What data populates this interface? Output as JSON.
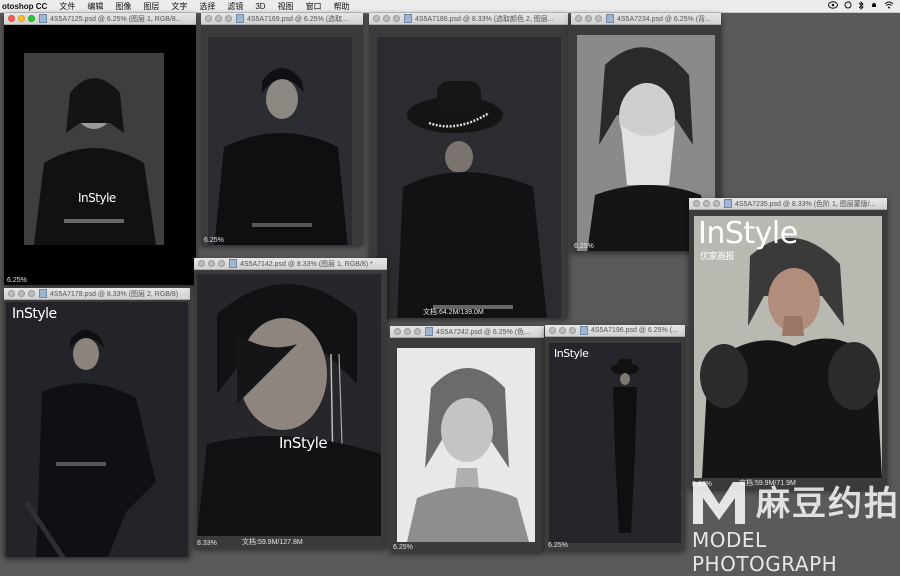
{
  "menubar": {
    "app_name": "otoshop CC",
    "items": [
      "文件",
      "编辑",
      "图像",
      "图层",
      "文字",
      "选择",
      "滤镜",
      "3D",
      "视图",
      "窗口",
      "帮助"
    ],
    "status_icons": [
      "creative-cloud-icon",
      "sync-icon",
      "bluetooth-icon",
      "bell-icon",
      "wifi-icon"
    ]
  },
  "windows": {
    "w1": {
      "title": "4S5A7125.psd @ 6.25% (图层 1, RGB/8...",
      "zoom": "6.25%",
      "brand": "InStyle"
    },
    "w2": {
      "title": "4S5A7169.psd @ 6.25% (选取...",
      "zoom": "6.25%"
    },
    "w3": {
      "title": "4S5A7186.psd @ 8.33% (选取颜色 2, 图层...",
      "doc_info": "文档:64.2M/139.0M"
    },
    "w4": {
      "title": "4S5A7234.psd @ 6.25% (背...",
      "zoom": "6.25%"
    },
    "w5": {
      "title": "4S5A7235.psd @ 8.33% (色阶 1, 图层蒙版/...",
      "zoom": "8.33%",
      "doc_info": "文档:59.9M/71.9M",
      "brand": "InStyle",
      "brand_sub": "优家画报"
    },
    "w6": {
      "title": "4S5A7178.psd @ 8.33% (图层 2, RGB/8)",
      "brand": "InStyle"
    },
    "w7": {
      "title": "4S5A7142.psd @ 8.33% (图层 1, RGB/8) *",
      "zoom": "8.33%",
      "doc_info": "文档:59.9M/127.8M",
      "brand": "InStyle"
    },
    "w8": {
      "title": "4S5A7242.psd @ 6.25% (色...",
      "zoom": "6.25%"
    },
    "w9": {
      "title": "4S5A7196.psd @ 6.25% (...",
      "zoom": "6.25%",
      "brand": "InStyle"
    }
  },
  "watermark": {
    "cn_text": "麻豆约拍",
    "en_text": "MODEL PHOTOGRAPH"
  },
  "colors": {
    "workspace": "#5a5a5a",
    "titlebar": "#dcdcdc",
    "canvas": "#3b3b3b"
  }
}
